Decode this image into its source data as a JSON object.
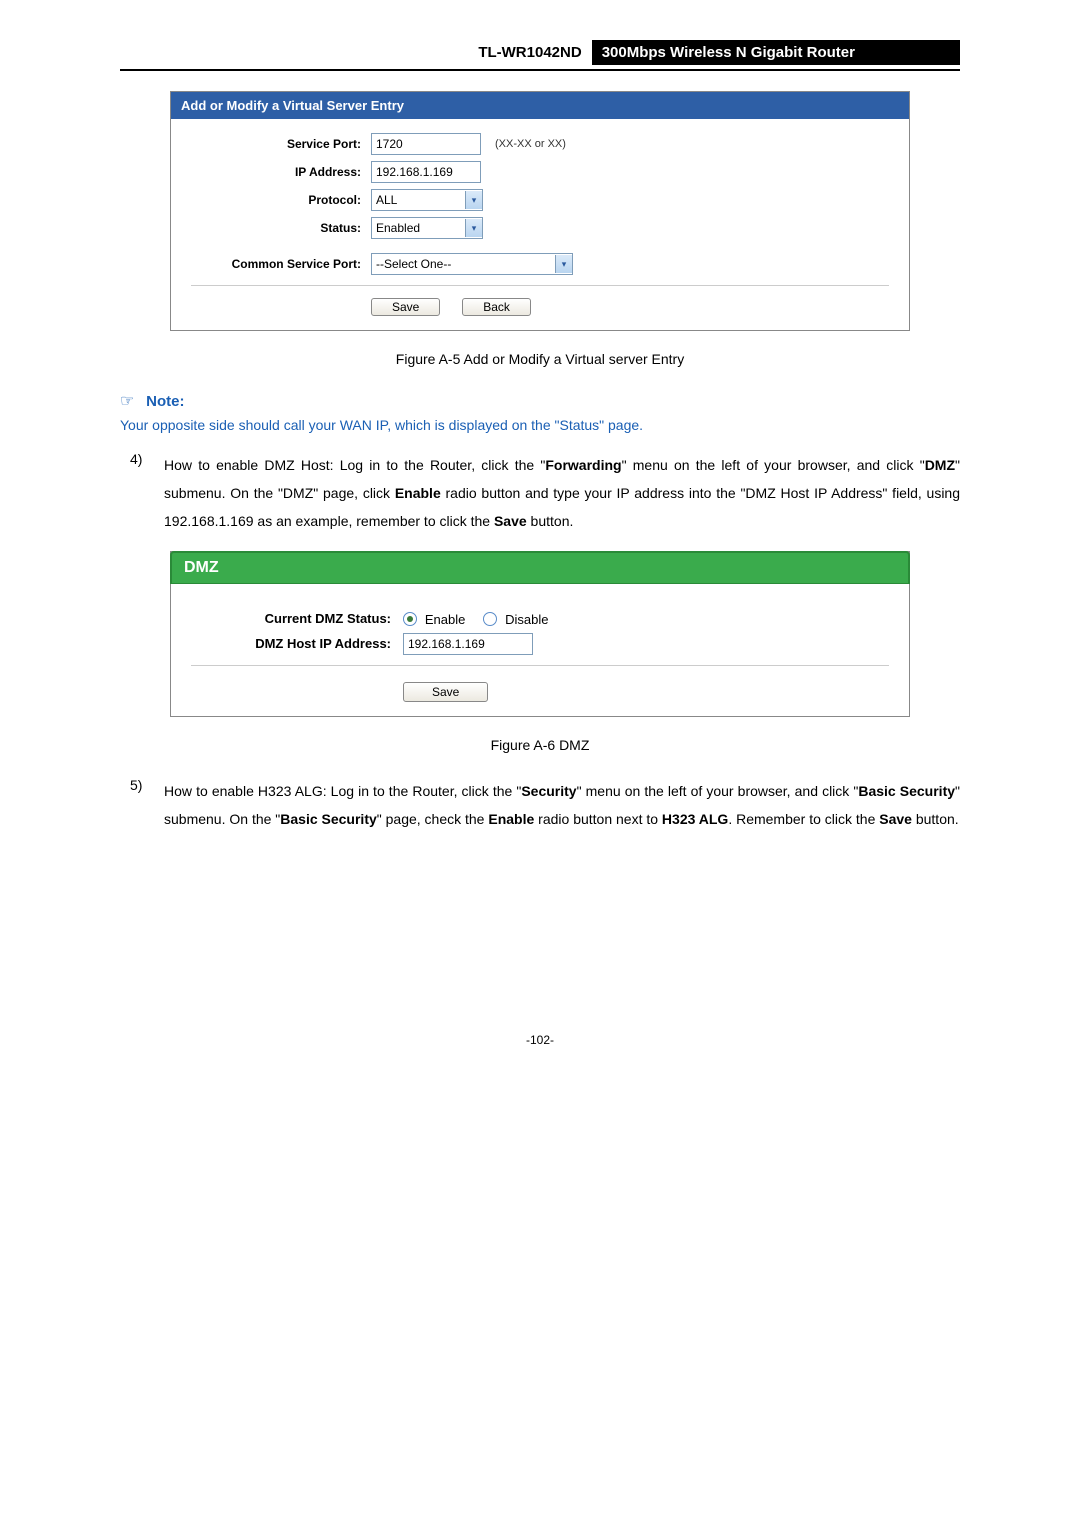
{
  "header": {
    "model": "TL-WR1042ND",
    "desc": "300Mbps Wireless N Gigabit Router"
  },
  "vs": {
    "title": "Add or Modify a Virtual Server Entry",
    "labels": {
      "service_port": "Service Port:",
      "ip_address": "IP Address:",
      "protocol": "Protocol:",
      "status": "Status:",
      "common_service_port": "Common Service Port:"
    },
    "values": {
      "service_port": "1720",
      "service_port_hint": "(XX-XX or XX)",
      "ip_address": "192.168.1.169",
      "protocol": "ALL",
      "status": "Enabled",
      "common_service_port": "--Select One--"
    },
    "buttons": {
      "save": "Save",
      "back": "Back"
    }
  },
  "caption_a5": "Figure A-5    Add or Modify a Virtual server Entry",
  "note": {
    "label": "Note:",
    "text": "Your opposite side should call your WAN IP, which is displayed on the \"Status\" page."
  },
  "item4": {
    "num": "4)",
    "t1": "How to enable DMZ Host: Log in to the Router, click the \"",
    "b1": "Forwarding",
    "t2": "\" menu on the left of your browser, and click \"",
    "b2": "DMZ",
    "t3": "\" submenu. On the \"DMZ\" page, click ",
    "b3": "Enable",
    "t4": " radio button and type your IP address into the \"DMZ Host IP Address\" field, using 192.168.1.169 as an example, remember to click the ",
    "b4": "Save",
    "t5": " button."
  },
  "dmz": {
    "title": "DMZ",
    "labels": {
      "current_status": "Current DMZ Status:",
      "host_ip": "DMZ Host IP Address:"
    },
    "options": {
      "enable": "Enable",
      "disable": "Disable"
    },
    "values": {
      "host_ip": "192.168.1.169"
    },
    "buttons": {
      "save": "Save"
    }
  },
  "caption_a6": "Figure A-6    DMZ",
  "item5": {
    "num": "5)",
    "t1": "How to enable H323 ALG: Log in to the Router, click the \"",
    "b1": "Security",
    "t2": "\" menu on the left of your browser, and click \"",
    "b2": "Basic Security",
    "t3": "\" submenu. On the \"",
    "b3": "Basic Security",
    "t4": "\" page, check the ",
    "b4": "Enable",
    "t5": " radio button next to ",
    "b5": "H323 ALG",
    "t6": ". Remember to click the ",
    "b6": "Save",
    "t7": " button."
  },
  "footer": "-102-",
  "chart_data": {
    "type": "table",
    "figures": [
      {
        "id": "A-5",
        "title": "Add or Modify a Virtual Server Entry",
        "fields": {
          "Service Port": "1720",
          "IP Address": "192.168.1.169",
          "Protocol": "ALL",
          "Status": "Enabled",
          "Common Service Port": "--Select One--"
        }
      },
      {
        "id": "A-6",
        "title": "DMZ",
        "fields": {
          "Current DMZ Status": "Enable",
          "DMZ Host IP Address": "192.168.1.169"
        }
      }
    ]
  }
}
